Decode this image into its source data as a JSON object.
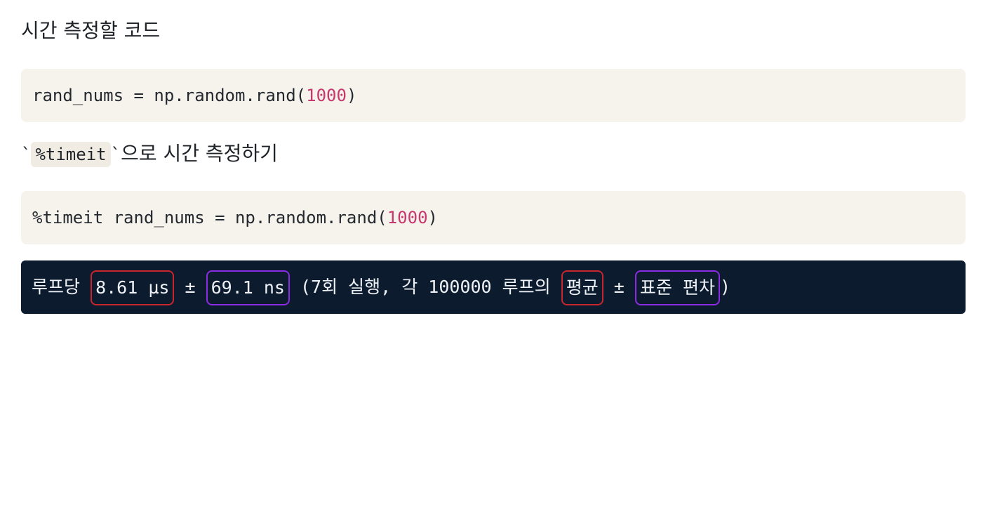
{
  "heading_1": "시간 측정할 코드",
  "code_1": {
    "prefix": "rand_nums = np.random.rand(",
    "number": "1000",
    "suffix": ")"
  },
  "heading_2": {
    "backtick_open": "`",
    "inline_code": "%timeit",
    "backtick_close": "`",
    "rest": "으로 시간 측정하기"
  },
  "code_2": {
    "prefix": "%timeit rand_nums = np.random.rand(",
    "number": "1000",
    "suffix": ")"
  },
  "output": {
    "lead": "루프당 ",
    "mean_value": "8.61 µs",
    "plus_minus_1": " ± ",
    "std_value": "69.1 ns",
    "middle": " (7회 실행, 각 100000 루프의 ",
    "mean_label": "평균",
    "plus_minus_2": " ± ",
    "std_label": "표준 편차",
    "close": ")"
  },
  "colors": {
    "mean_highlight": "#c8262c",
    "std_highlight": "#8b2be2",
    "number_literal": "#c8386e",
    "output_background": "#0c1b2e"
  }
}
